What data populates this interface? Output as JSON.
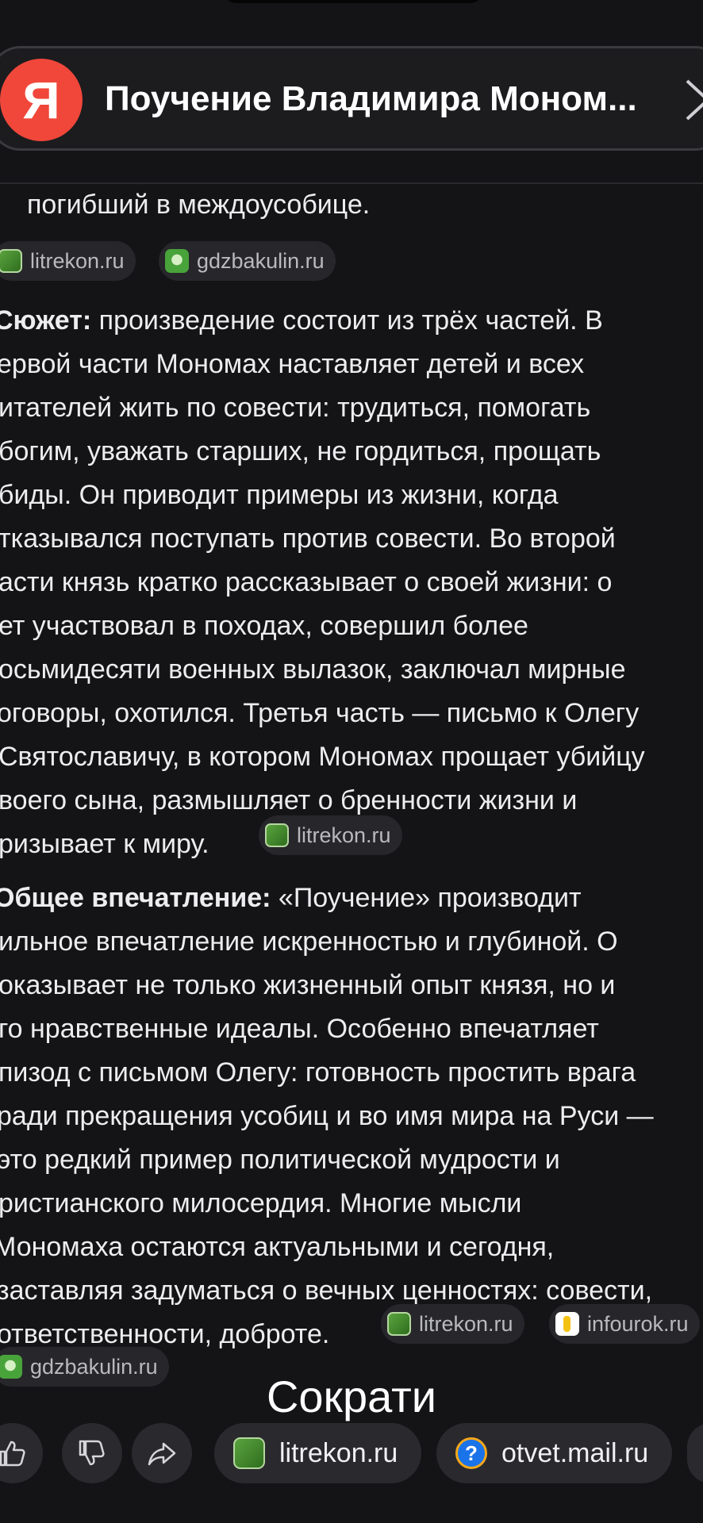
{
  "header": {
    "logo_letter": "Я",
    "title": "Поучение Владимира Моном..."
  },
  "lines": {
    "l0": "погибший в междоусобице.",
    "plot_label": "Сюжет:",
    "plot_l1_rest": " произведение состоит из трёх частей. В",
    "plot_l2": "ервой части Мономах наставляет детей и всех",
    "plot_l3": "итателей жить по совести: трудиться, помогать",
    "plot_l4": "богим, уважать старших, не гордиться, прощать",
    "plot_l5": "биды. Он приводит примеры из жизни, когда",
    "plot_l6": "тказывался поступать против совести. Во второй",
    "plot_l7": "асти князь кратко рассказывает о своей жизни: о",
    "plot_l8": "ет участвовал в походах, совершил более",
    "plot_l9": "осьмидесяти военных вылазок, заключал мирные",
    "plot_l10": "оговоры, охотился. Третья часть — письмо к Олегу",
    "plot_l11": "Святославичу, в котором Мономах прощает убийцу",
    "plot_l12": "воего сына, размышляет о бренности жизни и",
    "plot_l13": "ризывает к миру.",
    "imp_label": "Общее впечатление:",
    "imp_l1_rest": " «Поучение» производит",
    "imp_l2": "ильное впечатление искренностью и глубиной. О",
    "imp_l3": "оказывает не только жизненный опыт князя, но и",
    "imp_l4": "го нравственные идеалы. Особенно впечатляет",
    "imp_l5": "пизод с письмом Олегу: готовность простить врага",
    "imp_l6": "ради прекращения усобиц и во имя мира на Руси —",
    "imp_l7": "это редкий пример политической мудрости и",
    "imp_l8": "ристианского милосердия. Многие мысли",
    "imp_l9": "Мономаха остаются актуальными и сегодня,",
    "imp_l10": "заставляя задуматься о вечных ценностях: совести,",
    "imp_l11": "ответственности, доброте."
  },
  "chips": {
    "c1": "litrekon.ru",
    "c2": "gdzbakulin.ru",
    "c3": "litrekon.ru",
    "c4": "litrekon.ru",
    "c5": "infourok.ru",
    "c6": "gdzbakulin.ru"
  },
  "shorten_label": "Сократи",
  "bottom": {
    "source1": "litrekon.ru",
    "source2": "otvet.mail.ru",
    "mail_glyph": "?"
  }
}
